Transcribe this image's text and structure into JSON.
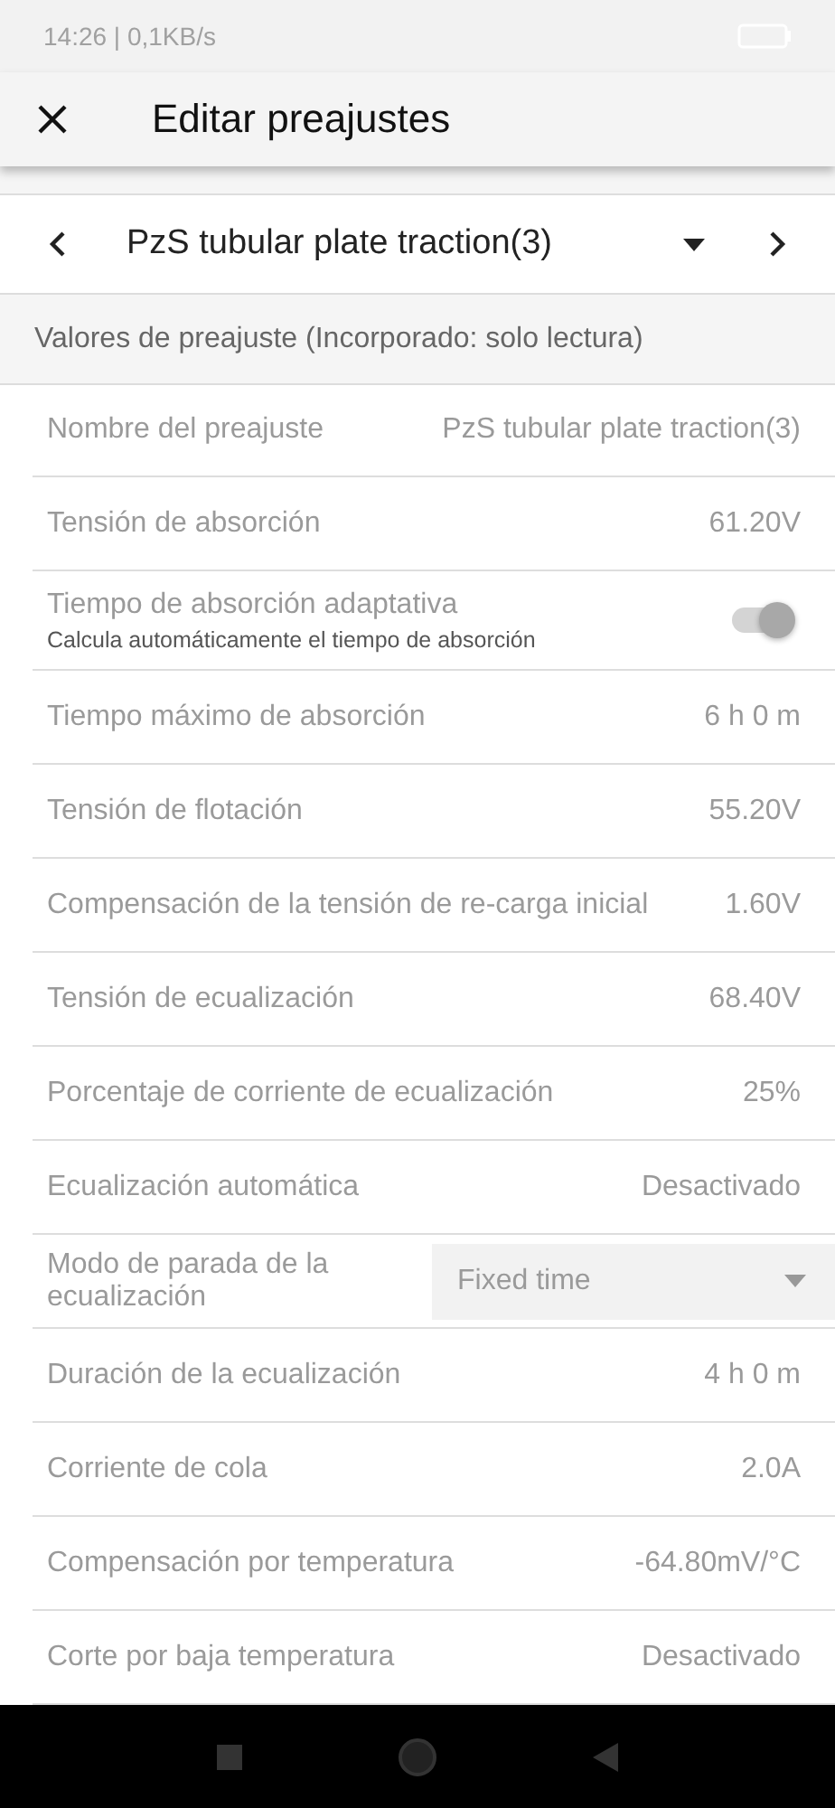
{
  "status_bar": {
    "text": "14:26 | 0,1KB/s"
  },
  "app_bar": {
    "title": "Editar preajustes"
  },
  "preset_selector": {
    "value": "PzS tubular plate traction(3)"
  },
  "section": {
    "title": "Valores de preajuste (Incorporado: solo lectura)"
  },
  "rows": [
    {
      "kind": "value",
      "label": "Nombre del preajuste",
      "value": "PzS tubular plate traction(3)"
    },
    {
      "kind": "value",
      "label": "Tensión de absorción",
      "value": "61.20V"
    },
    {
      "kind": "toggle",
      "label": "Tiempo de absorción adaptativa",
      "description": "Calcula automáticamente el tiempo de absorción",
      "on": true,
      "disabled": true
    },
    {
      "kind": "value",
      "label": "Tiempo máximo de absorción",
      "value": "6 h 0 m"
    },
    {
      "kind": "value",
      "label": "Tensión de flotación",
      "value": "55.20V"
    },
    {
      "kind": "value",
      "label": "Compensación de la tensión de re-carga inicial",
      "value": "1.60V"
    },
    {
      "kind": "value",
      "label": "Tensión de ecualización",
      "value": "68.40V"
    },
    {
      "kind": "value",
      "label": "Porcentaje de corriente de ecualización",
      "value": "25%"
    },
    {
      "kind": "value",
      "label": "Ecualización automática",
      "value": "Desactivado"
    },
    {
      "kind": "select",
      "label": "Modo de parada de la ecualización",
      "value": "Fixed time"
    },
    {
      "kind": "value",
      "label": "Duración de la ecualización",
      "value": "4 h 0 m"
    },
    {
      "kind": "value",
      "label": "Corriente de cola",
      "value": "2.0A"
    },
    {
      "kind": "value",
      "label": "Compensación por temperatura",
      "value": "-64.80mV/°C"
    },
    {
      "kind": "value",
      "label": "Corte por baja temperatura",
      "value": "Desactivado"
    }
  ]
}
